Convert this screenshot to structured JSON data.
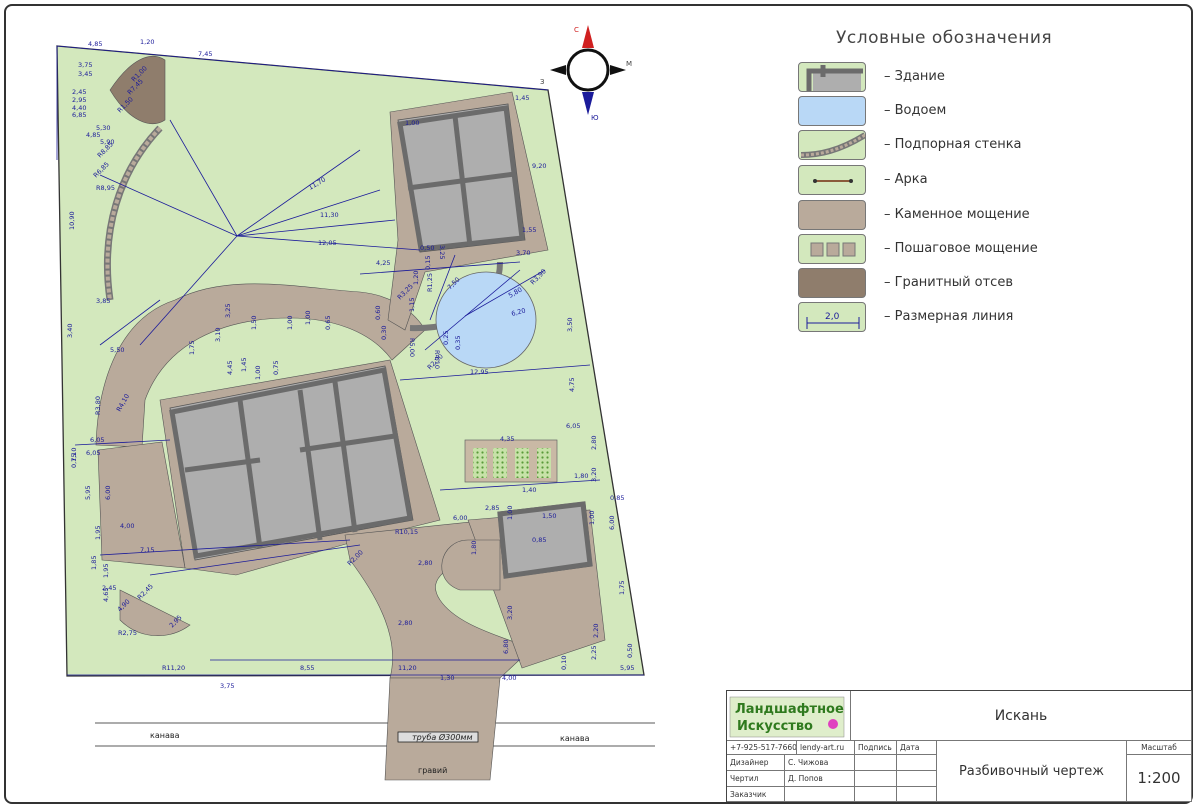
{
  "legend": {
    "title": "Условные обозначения",
    "items": [
      {
        "label": "– Здание",
        "kind": "building"
      },
      {
        "label": "– Водоем",
        "kind": "pond"
      },
      {
        "label": "– Подпорная стенка",
        "kind": "retaining-wall"
      },
      {
        "label": "– Арка",
        "kind": "arch"
      },
      {
        "label": "– Каменное мощение",
        "kind": "stone-paving"
      },
      {
        "label": "– Пошаговое мощение",
        "kind": "stepping-paving"
      },
      {
        "label": "– Гранитный отсев",
        "kind": "granite-screening"
      },
      {
        "label": "– Размерная линия",
        "kind": "dimension-line",
        "sample": "2,0"
      }
    ]
  },
  "compass": {
    "top": "С",
    "right": "М",
    "left": "З",
    "bottom": "Ю"
  },
  "plan": {
    "labels": {
      "ditch_left": "канава",
      "ditch_right": "канава",
      "pipe": "труба Ø300мм",
      "gravel": "гравий"
    },
    "dimensions": [
      "4,85",
      "1,20",
      "7,45",
      "3,75",
      "3,45",
      "2,45",
      "2,95",
      "4,40",
      "6,85",
      "5,30",
      "4,85",
      "5,90",
      "R1,00",
      "R7,45",
      "R1,50",
      "R8,85",
      "R6,85",
      "R8,95",
      "11,70",
      "11,30",
      "12,05",
      "4,25",
      "9,20",
      "1,45",
      "1,00",
      "3,25",
      "0,50",
      "1,55",
      "3,70",
      "R3,90",
      "5,80",
      "6,20",
      "7,50",
      "R3,25",
      "R5,00",
      "R4,10",
      "R2,90",
      "12,95",
      "4,75",
      "3,50",
      "10,90",
      "3,85",
      "3,40",
      "5,50",
      "6,05",
      "R4,10",
      "R3,80",
      "6,05",
      "1,10",
      "5,95",
      "0,75",
      "6,00",
      "4,00",
      "7,15",
      "1,95",
      "1,85",
      "1,95",
      "2,45",
      "4,65",
      "R2,45",
      "4,90",
      "R2,75",
      "2,95",
      "R2,00",
      "R10,15",
      "6,00",
      "2,80",
      "1,80",
      "2,80",
      "R11,20",
      "8,55",
      "11,20",
      "1,30",
      "4,00",
      "3,75",
      "0,10",
      "5,95",
      "2,20",
      "1,75",
      "6,00",
      "3,20",
      "1,80",
      "0,85",
      "1,40",
      "4,35",
      "6,05",
      "2,80",
      "2,85",
      "1,50",
      "1,00",
      "0,85",
      "1,00",
      "3,20",
      "6,80",
      "0,50",
      "2,25",
      "1,75",
      "3,10",
      "4,45",
      "1,45",
      "1,00",
      "0,75",
      "1,50",
      "3,25",
      "1,00",
      "1,00",
      "0,65",
      "0,60",
      "0,30",
      "1,15",
      "0,25",
      "0,15",
      "1,20",
      "R1,25",
      "0,35",
      "2,85",
      "0,85",
      "2,05",
      "0,70",
      "R4,70"
    ]
  },
  "title_block": {
    "logo_line1": "Ландшафтное",
    "logo_line2": "Искусство",
    "project": "Искань",
    "drawing": "Разбивочный чертеж",
    "phone": "+7-925-517-7660",
    "site": "lendy-art.ru",
    "col_signature": "Подпись",
    "col_date": "Дата",
    "scale_label": "Масштаб",
    "scale_value": "1:200",
    "rows": [
      {
        "role": "Дизайнер",
        "name": "С. Чижова"
      },
      {
        "role": "Чертил",
        "name": "Д. Попов"
      },
      {
        "role": "Заказчик",
        "name": ""
      }
    ]
  },
  "colors": {
    "lawn": "#d3e8bd",
    "building": "#aeaeae",
    "wall": "#6b6b6b",
    "stone_paving": "#b9aa9b",
    "granite": "#8f7d6c",
    "pond": "#b9d8f6",
    "dimension": "#1b1b9a",
    "logo_green": "#2f7a1e",
    "logo_magenta": "#e040c0"
  }
}
